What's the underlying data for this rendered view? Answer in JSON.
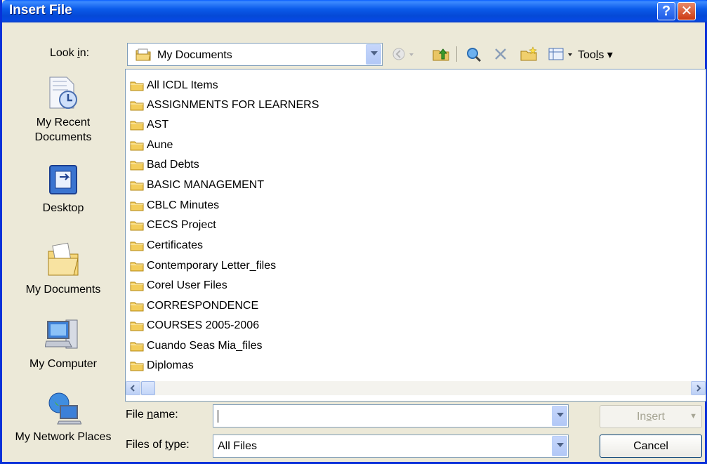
{
  "window": {
    "title": "Insert File"
  },
  "lookin": {
    "label_pre": "Look ",
    "label_u": "i",
    "label_post": "n:",
    "value": "My Documents"
  },
  "toolbar": {
    "tools_pre": "Too",
    "tools_u": "l",
    "tools_post": "s"
  },
  "places": [
    {
      "label": "My Recent Documents",
      "icon": "recent-documents-icon"
    },
    {
      "label": "Desktop",
      "icon": "desktop-icon"
    },
    {
      "label": "My Documents",
      "icon": "my-documents-icon"
    },
    {
      "label": "My Computer",
      "icon": "my-computer-icon"
    },
    {
      "label": "My Network Places",
      "icon": "network-places-icon"
    }
  ],
  "files": [
    "All ICDL Items",
    "ASSIGNMENTS FOR LEARNERS",
    "AST",
    "Aune",
    "Bad Debts",
    "BASIC MANAGEMENT",
    "CBLC Minutes",
    "CECS Project",
    "Certificates",
    "Contemporary Letter_files",
    "Corel User Files",
    "CORRESPONDENCE",
    "COURSES 2005-2006",
    "Cuando Seas Mia_files",
    "Diplomas"
  ],
  "filename": {
    "label_pre": "File ",
    "label_u": "n",
    "label_post": "ame:",
    "value": ""
  },
  "filetype": {
    "label_pre": "Files of ",
    "label_u": "t",
    "label_post": "ype:",
    "value": "All Files"
  },
  "buttons": {
    "insert_pre": "In",
    "insert_u": "s",
    "insert_post": "ert",
    "cancel": "Cancel"
  }
}
